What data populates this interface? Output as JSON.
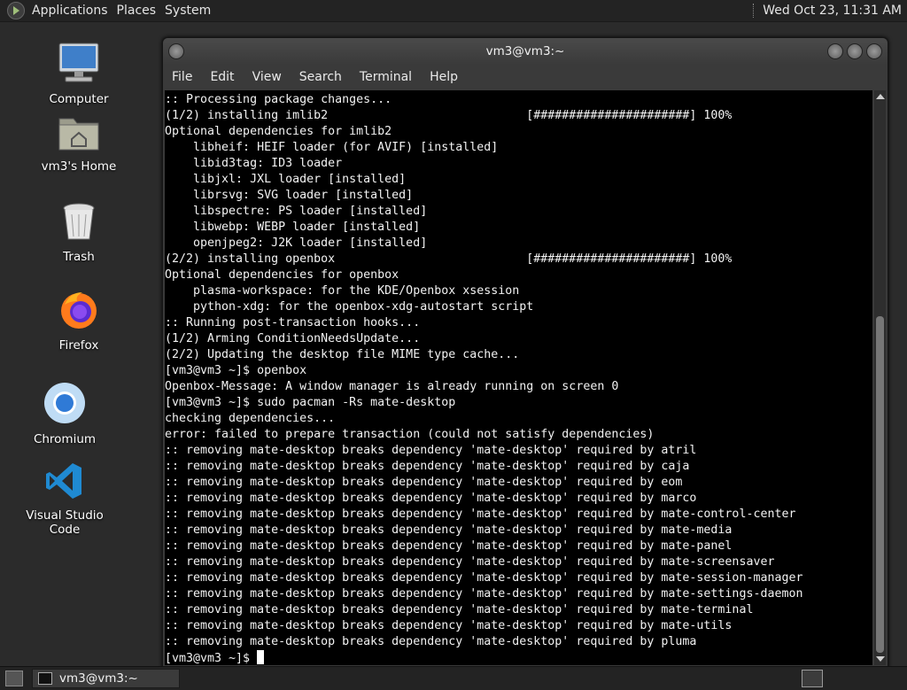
{
  "top_panel": {
    "menus": [
      "Applications",
      "Places",
      "System"
    ],
    "clock": "Wed Oct 23, 11:31 AM"
  },
  "desktop_icons": [
    {
      "label": "Computer",
      "icon": "computer-icon"
    },
    {
      "label": "vm3's Home",
      "icon": "home-folder-icon"
    },
    {
      "label": "Trash",
      "icon": "trash-icon"
    },
    {
      "label": "Firefox",
      "icon": "firefox-icon"
    },
    {
      "label": "Chromium",
      "icon": "chromium-icon"
    },
    {
      "label": "Visual Studio Code",
      "icon": "vscode-icon"
    }
  ],
  "terminal": {
    "title": "vm3@vm3:~",
    "menu": [
      "File",
      "Edit",
      "View",
      "Search",
      "Terminal",
      "Help"
    ],
    "lines": [
      ":: Processing package changes...",
      "(1/2) installing imlib2                            [######################] 100%",
      "Optional dependencies for imlib2",
      "    libheif: HEIF loader (for AVIF) [installed]",
      "    libid3tag: ID3 loader",
      "    libjxl: JXL loader [installed]",
      "    librsvg: SVG loader [installed]",
      "    libspectre: PS loader [installed]",
      "    libwebp: WEBP loader [installed]",
      "    openjpeg2: J2K loader [installed]",
      "(2/2) installing openbox                           [######################] 100%",
      "Optional dependencies for openbox",
      "    plasma-workspace: for the KDE/Openbox xsession",
      "    python-xdg: for the openbox-xdg-autostart script",
      ":: Running post-transaction hooks...",
      "(1/2) Arming ConditionNeedsUpdate...",
      "(2/2) Updating the desktop file MIME type cache...",
      "[vm3@vm3 ~]$ openbox",
      "Openbox-Message: A window manager is already running on screen 0",
      "[vm3@vm3 ~]$ sudo pacman -Rs mate-desktop",
      "checking dependencies...",
      "error: failed to prepare transaction (could not satisfy dependencies)",
      ":: removing mate-desktop breaks dependency 'mate-desktop' required by atril",
      ":: removing mate-desktop breaks dependency 'mate-desktop' required by caja",
      ":: removing mate-desktop breaks dependency 'mate-desktop' required by eom",
      ":: removing mate-desktop breaks dependency 'mate-desktop' required by marco",
      ":: removing mate-desktop breaks dependency 'mate-desktop' required by mate-control-center",
      ":: removing mate-desktop breaks dependency 'mate-desktop' required by mate-media",
      ":: removing mate-desktop breaks dependency 'mate-desktop' required by mate-panel",
      ":: removing mate-desktop breaks dependency 'mate-desktop' required by mate-screensaver",
      ":: removing mate-desktop breaks dependency 'mate-desktop' required by mate-session-manager",
      ":: removing mate-desktop breaks dependency 'mate-desktop' required by mate-settings-daemon",
      ":: removing mate-desktop breaks dependency 'mate-desktop' required by mate-terminal",
      ":: removing mate-desktop breaks dependency 'mate-desktop' required by mate-utils",
      ":: removing mate-desktop breaks dependency 'mate-desktop' required by pluma"
    ],
    "prompt": "[vm3@vm3 ~]$ "
  },
  "taskbar": {
    "task_label": "vm3@vm3:~"
  }
}
